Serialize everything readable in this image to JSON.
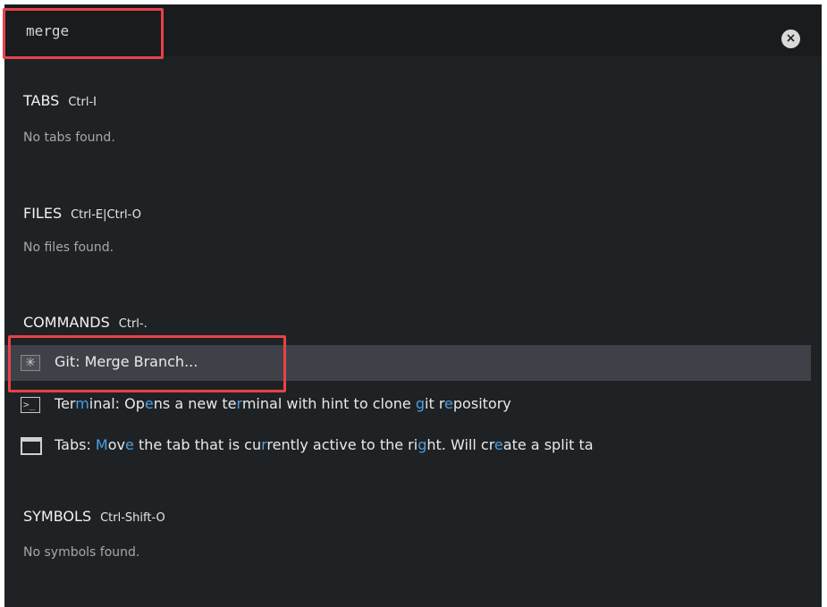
{
  "search": {
    "value": "merge",
    "placeholder": ""
  },
  "clear_button": {
    "icon": "close-icon",
    "glyph": "×"
  },
  "sections": {
    "tabs": {
      "title": "TABS",
      "shortcut": "Ctrl-I",
      "empty": "No tabs found."
    },
    "files": {
      "title": "FILES",
      "shortcut": "Ctrl-E|Ctrl-O",
      "empty": "No files found."
    },
    "commands": {
      "title": "COMMANDS",
      "shortcut": "Ctrl-.",
      "items": [
        {
          "icon": "git-icon",
          "icon_glyph": "✳",
          "label": "Git: Merge Branch...",
          "selected": true
        },
        {
          "icon": "terminal-icon",
          "icon_glyph": ">_",
          "label": "Terminal: Opens a new terminal with hint to clone git repository",
          "selected": false
        },
        {
          "icon": "tabs-icon",
          "icon_glyph": "",
          "label": "Tabs: Move the tab that is currently active to the right. Will create a split ta",
          "selected": false
        }
      ]
    },
    "symbols": {
      "title": "SYMBOLS",
      "shortcut": "Ctrl-Shift-O",
      "empty": "No symbols found."
    }
  },
  "colors": {
    "panel_bg": "#1f2224",
    "selected_row_bg": "#3e4248",
    "match_highlight": "#4a9fe3",
    "annotation_red": "#e8424a"
  }
}
